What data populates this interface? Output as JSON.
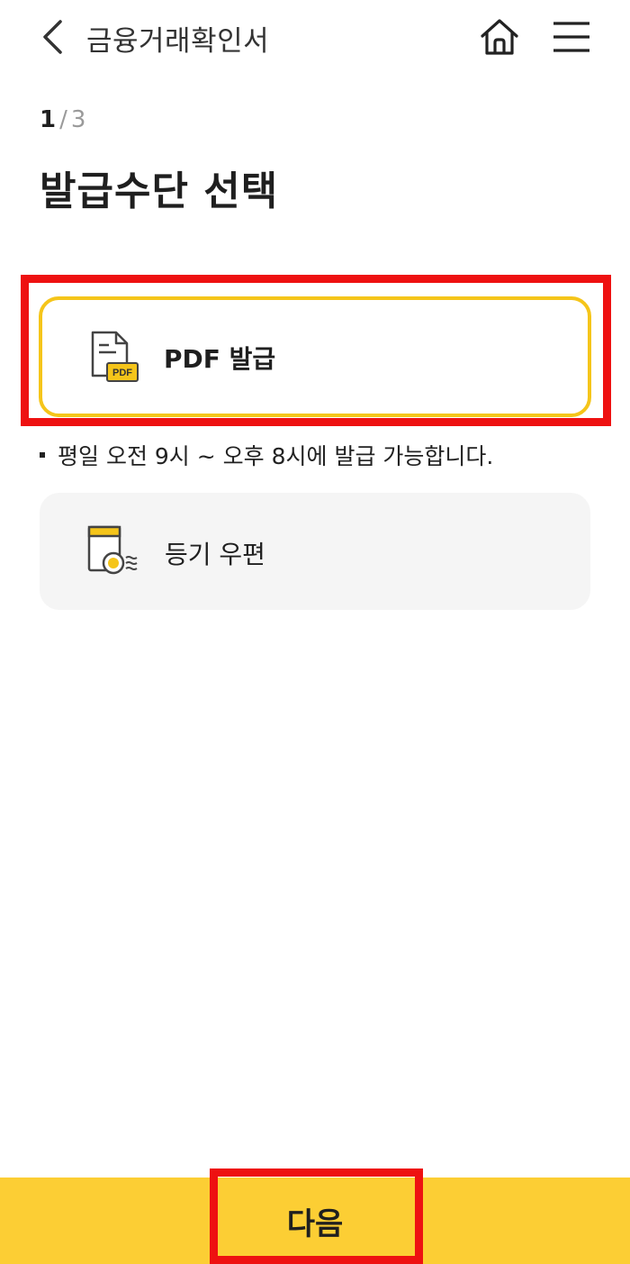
{
  "header": {
    "title": "금융거래확인서",
    "back_icon": "chevron-left-icon",
    "home_icon": "home-icon",
    "menu_icon": "hamburger-menu-icon"
  },
  "step": {
    "current": "1",
    "separator": "/",
    "total": "3"
  },
  "page_title": "발급수단 선택",
  "options": [
    {
      "label": "PDF 발급",
      "icon": "pdf-document-icon",
      "selected": true,
      "icon_text": "PDF"
    },
    {
      "label": "등기 우편",
      "icon": "registered-mail-icon",
      "selected": false
    }
  ],
  "notice": "평일 오전 9시 ~ 오후 8시에 발급 가능합니다.",
  "footer": {
    "next_label": "다음"
  },
  "colors": {
    "accent_yellow": "#fcce34",
    "selected_border": "#f5c51a",
    "highlight_red": "#ee1111",
    "option_bg": "#f5f5f5"
  }
}
